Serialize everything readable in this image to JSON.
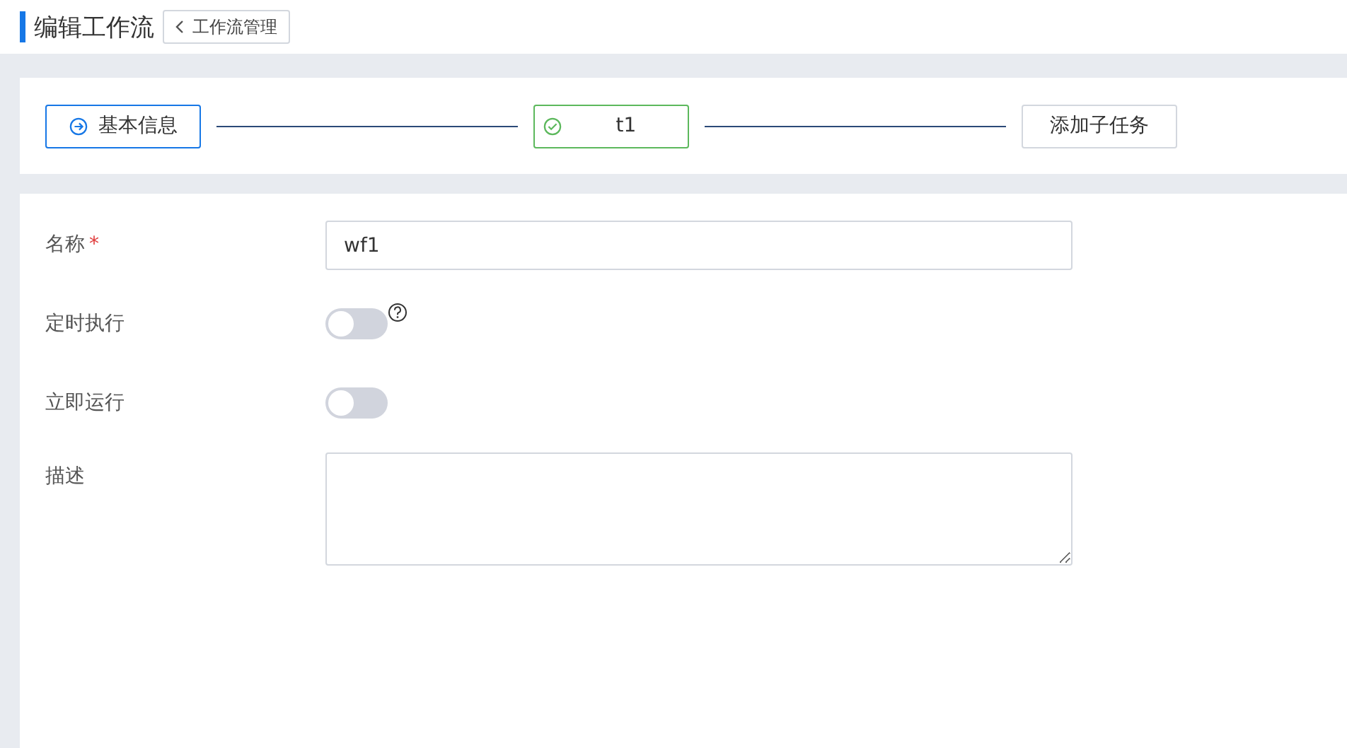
{
  "header": {
    "title": "编辑工作流",
    "back_button": "工作流管理"
  },
  "steps": [
    {
      "kind": "start",
      "label": "基本信息"
    },
    {
      "kind": "done",
      "label": "t1"
    },
    {
      "kind": "add",
      "label": "添加子任务"
    }
  ],
  "form": [
    {
      "kind": "text",
      "label": "名称",
      "required_mark": "*",
      "value": "wf1"
    },
    {
      "kind": "switch",
      "label": "定时执行",
      "on": false,
      "help": true
    },
    {
      "kind": "switch",
      "label": "立即运行",
      "on": false,
      "help": false
    },
    {
      "kind": "textarea",
      "label": "描述"
    }
  ]
}
